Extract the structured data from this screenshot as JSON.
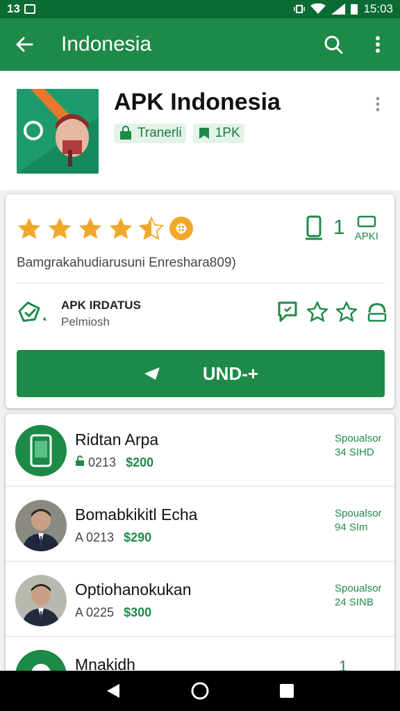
{
  "status_bar": {
    "time_left": "13",
    "time": "15:03"
  },
  "app_bar": {
    "title": "Indonesia"
  },
  "app": {
    "name": "APK Indonesia",
    "tags": [
      {
        "label": "Tranerli"
      },
      {
        "label": "1PK"
      }
    ]
  },
  "rating": {
    "stars": 4.5,
    "count": "1",
    "count_label": "APKI",
    "subtitle": "Bamgrakahudiarusuni Enreshara809)"
  },
  "status": {
    "title": "APK IRDATUS",
    "subtitle": "Pelmiosh"
  },
  "main_button": {
    "label": "UND-+"
  },
  "list": [
    {
      "name": "Ridtan Arpa",
      "code": "0213",
      "price": "$200",
      "side_line1": "Spoualsor",
      "side_line2": "34 SIHD",
      "avatar": "phone"
    },
    {
      "name": "Bomabkikitl Echa",
      "code": "A 0213",
      "price": "$290",
      "side_line1": "Spoualsor",
      "side_line2": "94 SIm",
      "avatar": "person"
    },
    {
      "name": "Optiohanokukan",
      "code": "A 0225",
      "price": "$300",
      "side_line1": "Spoualsor",
      "side_line2": "24 SINB",
      "avatar": "person"
    },
    {
      "name": "Mnakidh",
      "code": "",
      "price": "",
      "side_line1": "1",
      "side_line2": "",
      "avatar": "green"
    }
  ],
  "colors": {
    "primary": "#1d8a48",
    "status_bar": "#0b6b34",
    "star": "#f2a72b"
  }
}
